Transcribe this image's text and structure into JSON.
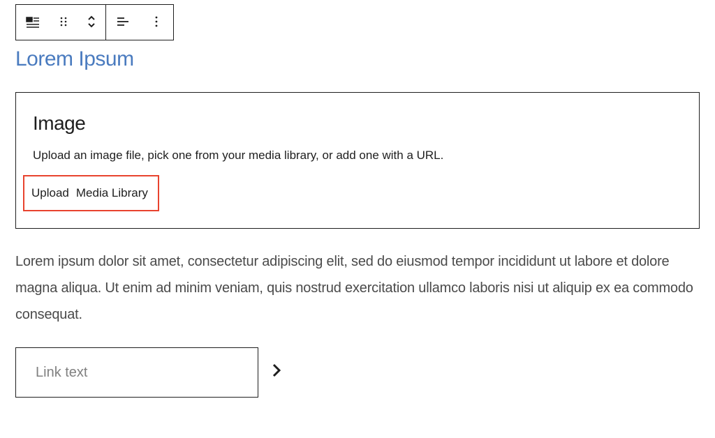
{
  "heading": "Lorem Ipsum",
  "image_block": {
    "title": "Image",
    "description": "Upload an image file, pick one from your media library, or add one with a URL.",
    "upload_label": "Upload",
    "media_library_label": "Media Library"
  },
  "paragraph": "Lorem ipsum dolor sit amet, consectetur adipiscing elit, sed do eiusmod tempor incididunt ut labore et dolore magna aliqua. Ut enim ad minim veniam, quis nostrud exercitation ullamco laboris nisi ut aliquip ex ea commodo consequat.",
  "link_input": {
    "placeholder": "Link text",
    "value": ""
  }
}
